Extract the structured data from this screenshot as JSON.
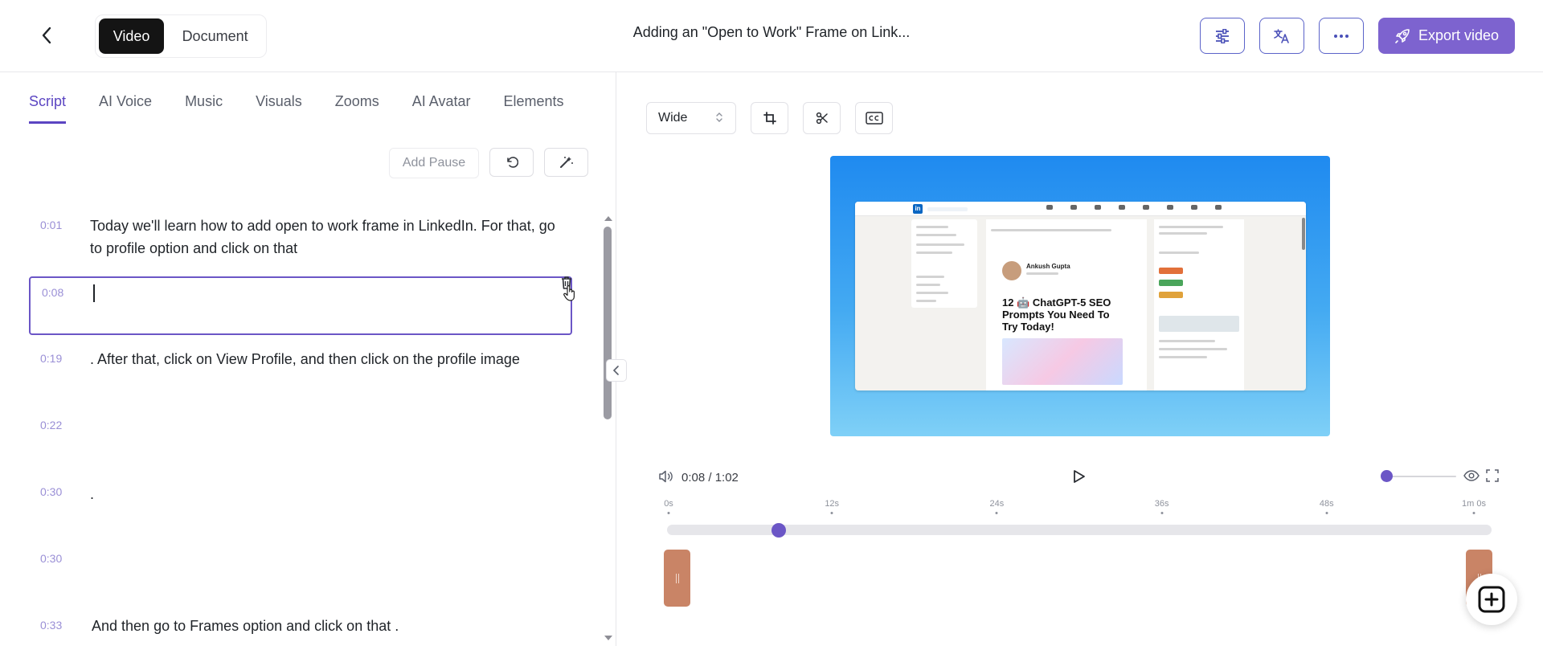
{
  "header": {
    "modes": [
      "Video",
      "Document"
    ],
    "active_mode": "Video",
    "title": "Adding an \"Open to Work\" Frame on Link...",
    "export_label": "Export video",
    "accent_color": "#7d63cf"
  },
  "left": {
    "tabs": [
      "Script",
      "AI Voice",
      "Music",
      "Visuals",
      "Zooms",
      "AI Avatar",
      "Elements"
    ],
    "active_tab": "Script",
    "add_pause_label": "Add Pause",
    "lines": [
      {
        "time": "0:01",
        "text": "Today we'll learn how to add open to work frame in LinkedIn. For that, go to profile option and click on that"
      },
      {
        "time": "0:08",
        "text": ""
      },
      {
        "time": "0:19",
        "text": ". After that, click on View Profile, and then click on the profile image"
      },
      {
        "time": "0:22",
        "text": ""
      },
      {
        "time": "0:30",
        "text": "."
      },
      {
        "time": "0:30",
        "text": ""
      },
      {
        "time": "0:33",
        "text": "And then go to Frames option and click on that ."
      }
    ]
  },
  "right": {
    "aspect": "Wide",
    "preview": {
      "author": "Ankush Gupta",
      "post_title": "12 🤖 ChatGPT-5 SEO Prompts You Need To Try Today!",
      "logo": "in"
    },
    "time_display": "0:08 / 1:02",
    "ruler": [
      "0s",
      "12s",
      "24s",
      "36s",
      "48s",
      "1m 0s"
    ],
    "playhead_fraction": 0.129
  }
}
